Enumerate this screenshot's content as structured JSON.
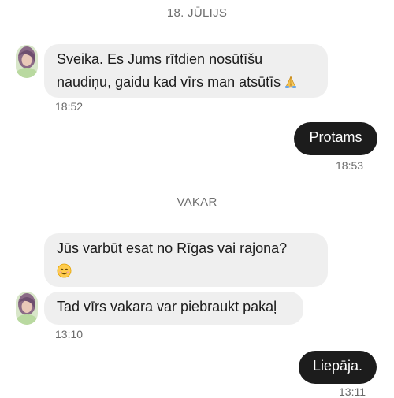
{
  "conversation": {
    "sections": [
      {
        "date_label": "18. JŪLIJS",
        "messages": [
          {
            "direction": "incoming",
            "line1": "Sveika. Es Jums rītdien nosūtīšu",
            "line2": "naudiņu, gaidu kad vīrs man atsūtīs",
            "emoji": "folded-hands-icon",
            "time": "18:52"
          },
          {
            "direction": "outgoing",
            "text": "Protams",
            "time": "18:53"
          }
        ]
      },
      {
        "date_label": "VAKAR",
        "messages": [
          {
            "direction": "incoming",
            "line1": "Jūs varbūt esat no Rīgas vai rajona?",
            "emoji": "smiling-face-icon"
          },
          {
            "direction": "incoming",
            "text": "Tad vīrs vakara var piebraukt pakaļ",
            "time": "13:10"
          },
          {
            "direction": "outgoing",
            "text": "Liepāja.",
            "time": "13:11"
          }
        ]
      }
    ]
  },
  "colors": {
    "incoming_bubble": "#efefef",
    "outgoing_bubble": "#1c1c1c",
    "timestamp": "#6b6b6b"
  }
}
